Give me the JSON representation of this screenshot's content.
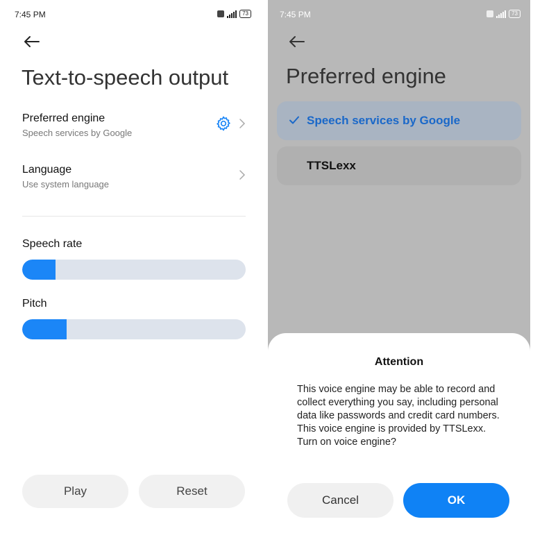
{
  "status_bar": {
    "time": "7:45 PM",
    "signal_texts": "Zıl Zıl",
    "battery": "73"
  },
  "left": {
    "title": "Text-to-speech output",
    "preferred_engine": {
      "title": "Preferred engine",
      "subtitle": "Speech services by Google"
    },
    "language": {
      "title": "Language",
      "subtitle": "Use system language"
    },
    "speech_rate": {
      "label": "Speech rate",
      "value_fraction": 0.15
    },
    "pitch": {
      "label": "Pitch",
      "value_fraction": 0.2
    },
    "play_button": "Play",
    "reset_button": "Reset"
  },
  "right": {
    "title": "Preferred engine",
    "options": [
      {
        "label": "Speech services by Google",
        "selected": true
      },
      {
        "label": "TTSLexx",
        "selected": false
      }
    ],
    "dialog": {
      "title": "Attention",
      "message": "This voice engine may be able to record and collect everything you say, including personal data like passwords and credit card numbers. This voice engine is provided by TTSLexx. Turn on voice engine?",
      "cancel": "Cancel",
      "ok": "OK"
    }
  },
  "colors": {
    "accent": "#1b86f7",
    "ok_button": "#0f82f5",
    "track": "#dde3ec"
  },
  "icons": [
    "back-arrow-icon",
    "gear-icon",
    "chevron-right-icon",
    "check-icon",
    "signal-icon",
    "battery-icon"
  ]
}
